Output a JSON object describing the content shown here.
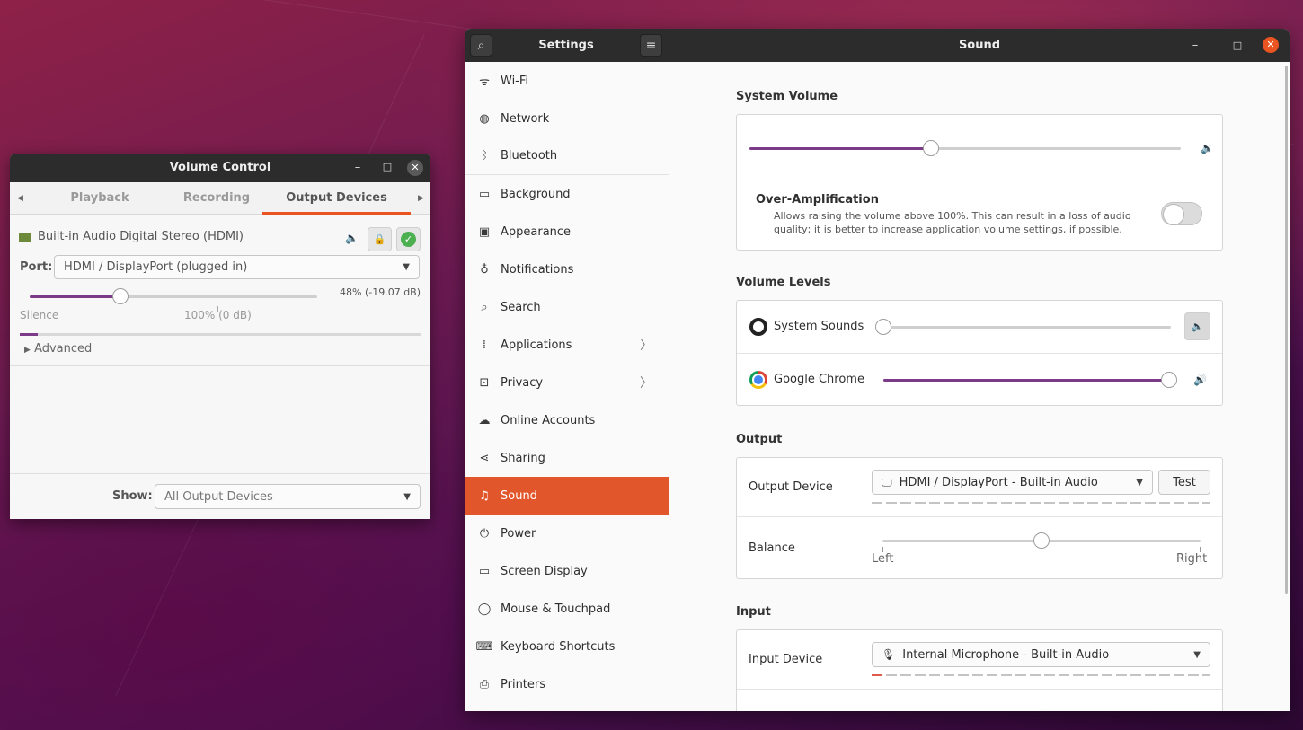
{
  "settings": {
    "header_title": "Settings",
    "page_title": "Sound",
    "sidebar": [
      {
        "label": "Wi-Fi",
        "icon": "wifi-icon"
      },
      {
        "label": "Network",
        "icon": "network-icon"
      },
      {
        "label": "Bluetooth",
        "icon": "bluetooth-icon"
      },
      {
        "label": "Background",
        "icon": "background-icon"
      },
      {
        "label": "Appearance",
        "icon": "appearance-icon"
      },
      {
        "label": "Notifications",
        "icon": "notifications-icon"
      },
      {
        "label": "Search",
        "icon": "search-icon"
      },
      {
        "label": "Applications",
        "icon": "applications-icon"
      },
      {
        "label": "Privacy",
        "icon": "privacy-icon"
      },
      {
        "label": "Online Accounts",
        "icon": "cloud-icon"
      },
      {
        "label": "Sharing",
        "icon": "share-icon"
      },
      {
        "label": "Sound",
        "icon": "music-note-icon"
      },
      {
        "label": "Power",
        "icon": "power-icon"
      },
      {
        "label": "Screen Display",
        "icon": "display-icon"
      },
      {
        "label": "Mouse & Touchpad",
        "icon": "mouse-icon"
      },
      {
        "label": "Keyboard Shortcuts",
        "icon": "keyboard-icon"
      },
      {
        "label": "Printers",
        "icon": "printer-icon"
      }
    ],
    "active_item": "Sound",
    "system_volume": {
      "title": "System Volume",
      "level": 0.42,
      "over_amp_title": "Over-Amplification",
      "over_amp_desc_1": "Allows raising the volume above 100%. This can result in a loss of audio",
      "over_amp_desc_2": "quality; it is better to increase application volume settings, if possible.",
      "over_amp_enabled": false
    },
    "volume_levels": {
      "title": "Volume Levels",
      "apps": [
        {
          "name": "System Sounds",
          "level": 0.0,
          "muted": true
        },
        {
          "name": "Google Chrome",
          "level": 1.0,
          "muted": false
        }
      ]
    },
    "output": {
      "title": "Output",
      "device_label": "Output Device",
      "device_value": "HDMI / DisplayPort - Built-in Audio",
      "test_label": "Test",
      "balance_label": "Balance",
      "balance_level": 0.5,
      "left_label": "Left",
      "right_label": "Right"
    },
    "input": {
      "title": "Input",
      "device_label": "Input Device",
      "device_value": "Internal Microphone - Built-in Audio"
    }
  },
  "volume_control": {
    "title": "Volume Control",
    "tabs": [
      "Playback",
      "Recording",
      "Output Devices"
    ],
    "active_tab": "Output Devices",
    "device_name": "Built-in Audio Digital Stereo (HDMI)",
    "port_label": "Port:",
    "port_value": "HDMI / DisplayPort (plugged in)",
    "level": 0.48,
    "level_text": "48% (-19.07 dB)",
    "silence_label": "Silence",
    "full_label": "100% (0 dB)",
    "advanced_label": "Advanced",
    "show_label": "Show:",
    "show_value": "All Output Devices"
  },
  "colors": {
    "accent": "#e95420",
    "slider_fill": "#7b3b89",
    "titlebar": "#2c2c2c"
  }
}
